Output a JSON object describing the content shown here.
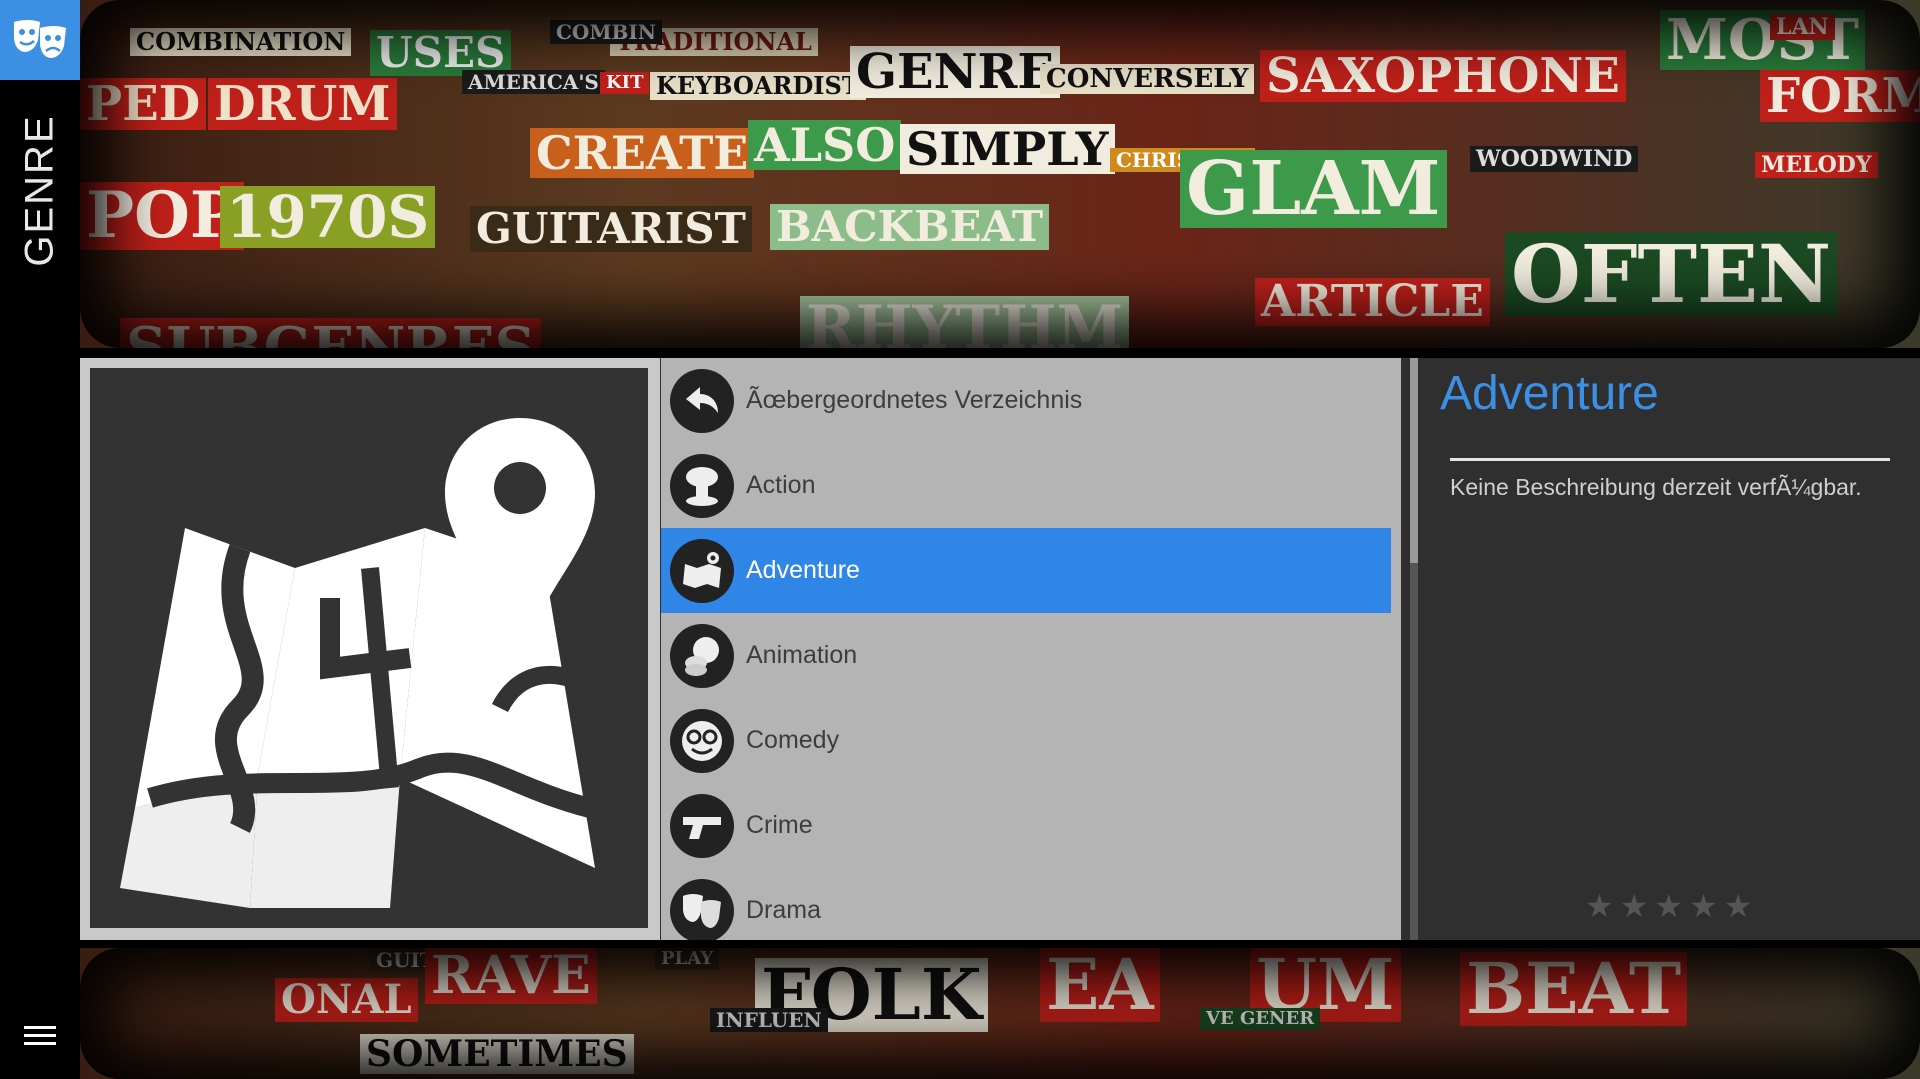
{
  "app": {
    "section_title": "GENRE",
    "logo_icon": "theater-masks-icon",
    "menu_icon": "hamburger-menu-icon",
    "accent_color": "#3d8fe3"
  },
  "banner_top": {
    "words": [
      "COMBINATION",
      "TRADITIONAL",
      "PED",
      "DRUM",
      "USES",
      "AMERICA'S",
      "COMBIN",
      "KIT",
      "KEYBOARDIST",
      "GENRE",
      "CONVERSELY",
      "SAXOPHONE",
      "MOST",
      "FORM",
      "CREATE",
      "ALSO",
      "SIMPLY",
      "CHRISTIAN",
      "GLAM",
      "WOODWIND",
      "MELODY",
      "POP",
      "1970S",
      "GUITARIST",
      "BACKBEAT",
      "OFTEN",
      "ARTICLE",
      "SUBGENRES",
      "RHYTHM",
      "LAN"
    ]
  },
  "banner_bottom": {
    "words": [
      "GUIT",
      "RAVE",
      "PLAY",
      "FOLK",
      "EA",
      "UM",
      "BEAT",
      "SOMETIMES",
      "INFLUEN",
      "VE GENER",
      "ONAL"
    ]
  },
  "poster": {
    "icon": "map-pin-icon"
  },
  "list": {
    "items": [
      {
        "label": "Ãœbergeordnetes Verzeichnis",
        "icon": "back-arrow-icon"
      },
      {
        "label": "Action",
        "icon": "explosion-icon"
      },
      {
        "label": "Adventure",
        "icon": "map-icon",
        "selected": true
      },
      {
        "label": "Animation",
        "icon": "film-reel-icon"
      },
      {
        "label": "Comedy",
        "icon": "comedy-face-icon"
      },
      {
        "label": "Crime",
        "icon": "pistol-icon"
      },
      {
        "label": "Drama",
        "icon": "drama-masks-icon"
      }
    ]
  },
  "detail": {
    "title": "Adventure",
    "description": "Keine Beschreibung derzeit verfÃ¼gbar.",
    "rating": {
      "stars_filled": 0,
      "stars_total": 5
    }
  }
}
